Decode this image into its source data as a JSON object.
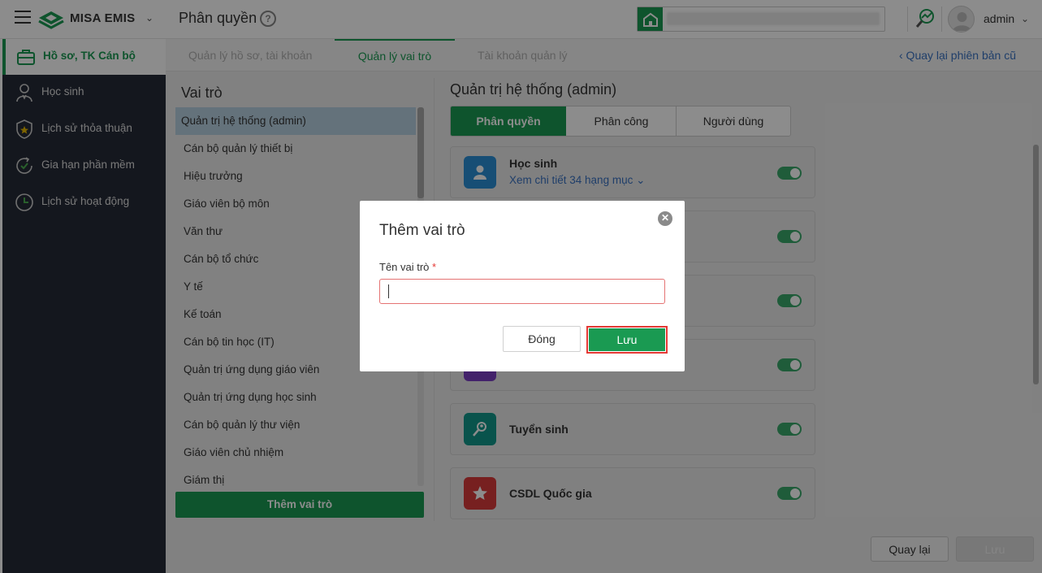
{
  "topbar": {
    "brand": "MISA EMIS",
    "page_title": "Phân quyền",
    "help_glyph": "?",
    "username": "admin",
    "icons": [
      "menu-icon",
      "misa-logo-icon",
      "school-icon",
      "analytics-icon",
      "user-avatar-icon"
    ]
  },
  "sidebar": {
    "items": [
      {
        "label": "Hồ sơ, TK Cán bộ",
        "icon": "briefcase-icon",
        "active": true
      },
      {
        "label": "Học sinh",
        "icon": "student-icon"
      },
      {
        "label": "Lịch sử thỏa thuận",
        "icon": "shield-star-icon"
      },
      {
        "label": "Gia hạn phần mềm",
        "icon": "renew-icon"
      },
      {
        "label": "Lịch sử hoạt động",
        "icon": "clock-icon"
      }
    ]
  },
  "tabs": [
    {
      "label": "Quản lý hồ sơ, tài khoản"
    },
    {
      "label": "Quản lý vai trò",
      "active": true
    },
    {
      "label": "Tài khoản quản lý"
    }
  ],
  "back_link": "‹ Quay lại phiên bản cũ",
  "roles_panel": {
    "title": "Vai trò",
    "items": [
      "Quản trị hệ thống (admin)",
      "Cán bộ quản lý thiết bị",
      "Hiệu trưởng",
      "Giáo viên bộ môn",
      "Văn thư",
      "Cán bộ tổ chức",
      "Y tế",
      "Kế toán",
      "Cán bộ tin học (IT)",
      "Quản trị ứng dụng giáo viên",
      "Quản trị ứng dụng học sinh",
      "Cán bộ quản lý thư viện",
      "Giáo viên chủ nhiệm",
      "Giám thị"
    ],
    "add_button": "Thêm vai trò"
  },
  "detail": {
    "title": "Quản trị hệ thống (admin)",
    "segments": [
      "Phân quyền",
      "Phân công",
      "Người dùng"
    ],
    "cards": [
      {
        "title": "Học sinh",
        "sub": "Xem chi tiết 34 hạng mục ⌄",
        "color": "#2b8fd6",
        "icon": "student-card-icon",
        "enabled": true
      },
      {
        "title": "",
        "sub": "",
        "color": "#1e88c8",
        "icon": "module-icon",
        "enabled": true
      },
      {
        "title": "",
        "sub": "",
        "color": "#1e88c8",
        "icon": "module-icon",
        "enabled": true
      },
      {
        "title": "",
        "sub": "",
        "color": "#7b3fc4",
        "icon": "module-icon",
        "enabled": true
      },
      {
        "title": "Tuyển sinh",
        "sub": "",
        "color": "#12978a",
        "icon": "admission-icon",
        "enabled": true
      },
      {
        "title": "CSDL Quốc gia",
        "sub": "",
        "color": "#d93b3b",
        "icon": "star-icon",
        "enabled": true
      }
    ]
  },
  "footer": {
    "back": "Quay lại",
    "save": "Lưu"
  },
  "modal": {
    "title": "Thêm vai trò",
    "field_label": "Tên vai trò",
    "required_mark": "*",
    "field_value": "",
    "close_button": "Đóng",
    "save_button": "Lưu",
    "close_glyph": "✕"
  }
}
